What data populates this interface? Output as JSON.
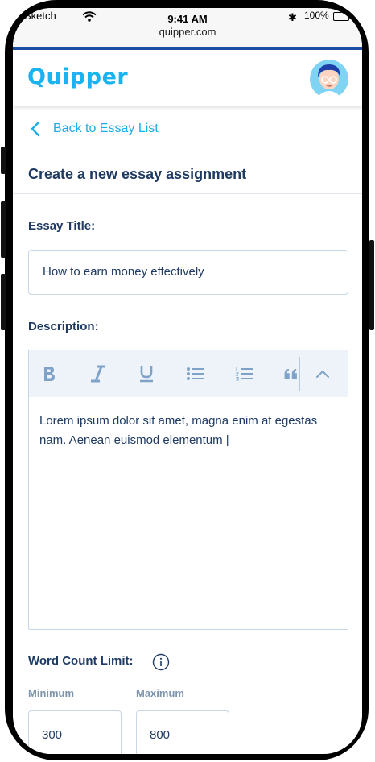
{
  "status_bar": {
    "carrier": "Sketch",
    "time": "9:41 AM",
    "url": "quipper.com",
    "battery": "100%"
  },
  "header": {
    "logo": "Quipper"
  },
  "nav": {
    "back_label": "Back to Essay List"
  },
  "page": {
    "title": "Create a new essay assignment"
  },
  "form": {
    "essay_title_label": "Essay Title:",
    "essay_title_value": "How to earn money effectively",
    "description_label": "Description:",
    "description_value": "Lorem ipsum dolor sit amet, magna enim at egestas nam. Aenean euismod elementum |",
    "toolbar": [
      "bold-icon",
      "italic-icon",
      "underline-icon",
      "bullet-list-icon",
      "numbered-list-icon",
      "quote-icon",
      "chevron-up-icon"
    ],
    "word_count_label": "Word Count Limit:",
    "minimum_label": "Minimum",
    "maximum_label": "Maximum",
    "minimum_value": "300",
    "maximum_value": "800"
  },
  "colors": {
    "brand": "#19b4f0",
    "heading": "#1f3b63",
    "accent_bar": "#1b4fa3",
    "toolbar_icon": "#7fa3c8"
  }
}
